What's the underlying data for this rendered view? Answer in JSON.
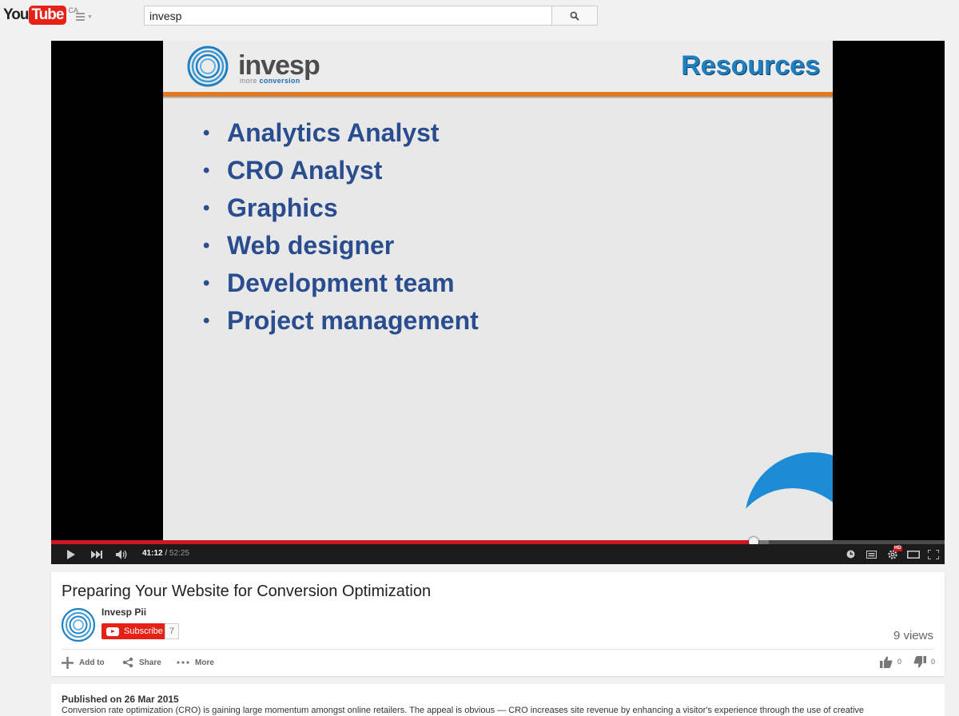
{
  "masthead": {
    "logo_you": "You",
    "logo_tube": "Tube",
    "country_code": "CA",
    "search_value": "invesp",
    "icons": {
      "guide": "menu-icon",
      "search": "search-icon"
    }
  },
  "player": {
    "slide": {
      "brand": "invesp",
      "tagline_a": "more ",
      "tagline_b": "conversion",
      "title": "Resources",
      "bullets": [
        "Analytics Analyst",
        "CRO Analyst",
        "Graphics",
        "Web designer",
        "Development team",
        "Project management"
      ]
    },
    "current_time": "41:12",
    "time_separator": " / ",
    "duration": "52:25",
    "progress_fraction": 0.786,
    "buffered_fraction": 0.803,
    "hd_badge": "HD",
    "colors": {
      "progress": "#cc181e",
      "subscribe": "#e62117",
      "slide_title": "#1f7fbf",
      "slide_bullets": "#2a4d8f",
      "slide_rule": "#e07b25"
    }
  },
  "video": {
    "title": "Preparing Your Website for Conversion Optimization",
    "channel": "Invesp Pii",
    "subscribe_label": "Subscribe",
    "subscriber_count": "7",
    "views": "9 views",
    "actions": {
      "add_to": "Add to",
      "share": "Share",
      "more": "More"
    },
    "likes": "0",
    "dislikes": "0"
  },
  "description": {
    "published": "Published on 26 Mar 2015",
    "text": "Conversion rate optimization (CRO) is gaining large momentum amongst online retailers. The appeal is obvious — CRO increases site revenue by enhancing a visitor's experience through the use of creative"
  }
}
